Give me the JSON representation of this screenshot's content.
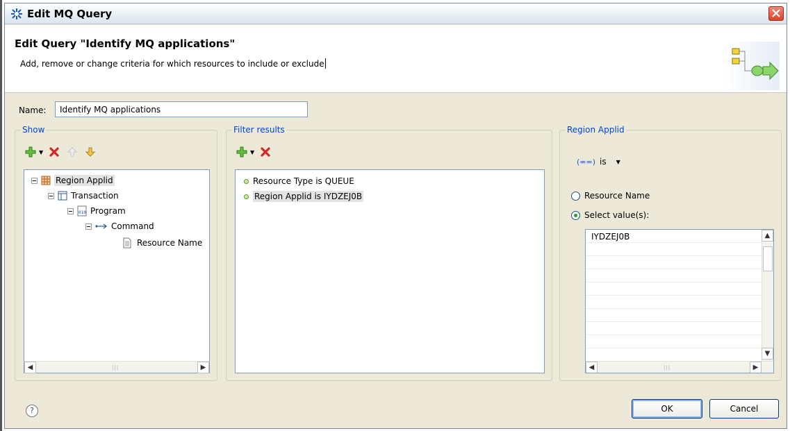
{
  "window": {
    "title": "Edit MQ Query"
  },
  "banner": {
    "title": "Edit Query \"Identify MQ applications\"",
    "description": "Add, remove or change criteria for which resources to include or exclude"
  },
  "name_field": {
    "label": "Name:",
    "value": "Identify MQ applications"
  },
  "show": {
    "label": "Show",
    "tree": [
      {
        "label": "Region Applid",
        "icon": "region-icon",
        "level": 0,
        "selected": true
      },
      {
        "label": "Transaction",
        "icon": "transaction-icon",
        "level": 1
      },
      {
        "label": "Program",
        "icon": "program-icon",
        "level": 2
      },
      {
        "label": "Command",
        "icon": "command-icon",
        "level": 3
      },
      {
        "label": "Resource Name",
        "icon": "document-icon",
        "level": 4
      }
    ]
  },
  "filter": {
    "label": "Filter results",
    "items": [
      {
        "label": "Resource Type is QUEUE"
      },
      {
        "label": "Region Applid is IYDZEJ0B",
        "selected": true
      }
    ]
  },
  "region": {
    "label": "Region Applid",
    "operator_symbol": "(==)",
    "operator": "is",
    "options": [
      {
        "label": "Resource Name",
        "checked": false
      },
      {
        "label": "Select value(s):",
        "checked": true
      }
    ],
    "values": [
      "IYDZEJ0B",
      "",
      "",
      "",
      "",
      "",
      "",
      "",
      "",
      ""
    ]
  },
  "buttons": {
    "ok": "OK",
    "cancel": "Cancel",
    "help": "?"
  },
  "colors": {
    "group_label": "#0046d5",
    "background": "#ece9d8"
  }
}
